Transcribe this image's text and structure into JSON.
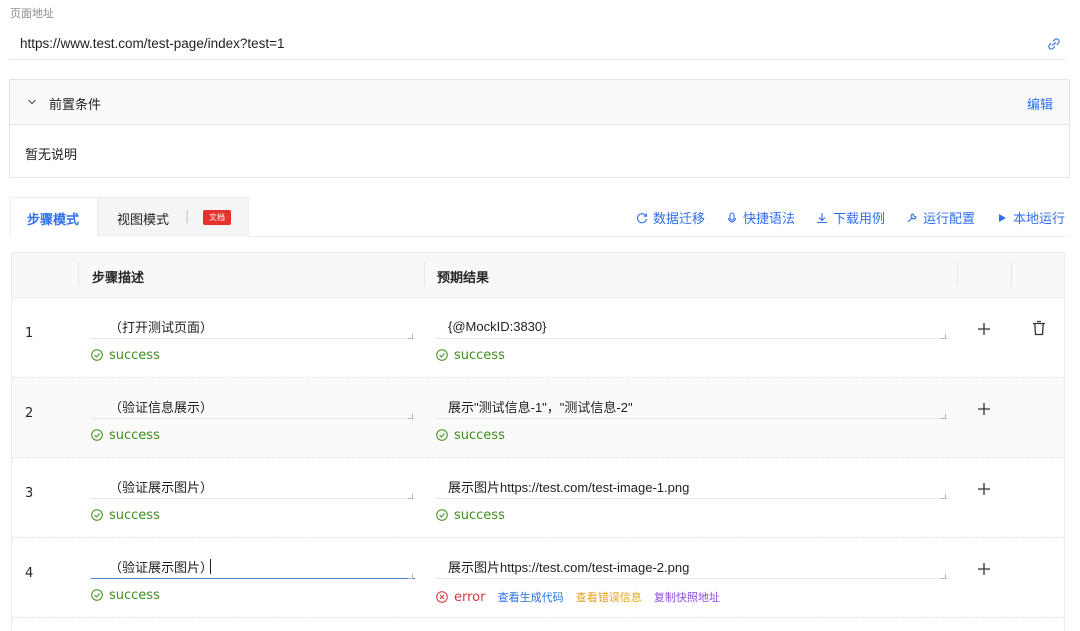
{
  "page_url": {
    "label": "页面地址",
    "value": "https://www.test.com/test-page/index?test=1"
  },
  "precondition": {
    "title": "前置条件",
    "edit_label": "编辑",
    "body": "暂无说明"
  },
  "tabs": [
    {
      "label": "步骤模式",
      "active": true
    },
    {
      "label": "视图模式",
      "separator": "|",
      "badge": "文档",
      "active": false
    }
  ],
  "toolbar": {
    "data_migrate": "数据迁移",
    "quick_syntax": "快捷语法",
    "download_cases": "下载用例",
    "run_config": "运行配置",
    "run_local": "本地运行"
  },
  "table": {
    "headers": {
      "desc": "步骤描述",
      "expected": "预期结果"
    },
    "rows": [
      {
        "index": "1",
        "desc": "（打开测试页面）",
        "expected": "{@MockID:3830}",
        "desc_status": "success",
        "exp_status": "success"
      },
      {
        "index": "2",
        "desc": "（验证信息展示）",
        "expected": "展示\"测试信息-1\"，\"测试信息-2\"",
        "desc_status": "success",
        "exp_status": "success"
      },
      {
        "index": "3",
        "desc": "（验证展示图片）",
        "expected": "展示图片https://test.com/test-image-1.png",
        "desc_status": "success",
        "exp_status": "success"
      },
      {
        "index": "4",
        "desc": "（验证展示图片）",
        "expected": "展示图片https://test.com/test-image-2.png",
        "desc_status": "success",
        "exp_status": "error",
        "error_links": {
          "view_code": "查看生成代码",
          "view_error": "查看错误信息",
          "copy_snapshot": "复制快照地址"
        }
      }
    ]
  },
  "colors": {
    "primary": "#2f6fed",
    "success": "#3f8f1c",
    "error": "#d9363e",
    "warning": "#e8a317",
    "purple": "#8b4fd8",
    "badge": "#e5322d"
  }
}
